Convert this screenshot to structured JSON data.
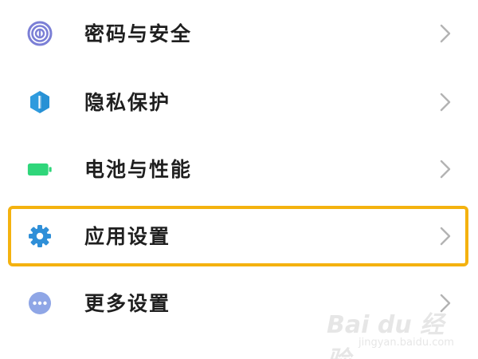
{
  "settings": {
    "items": [
      {
        "label": "密码与安全",
        "icon": "fingerprint-icon"
      },
      {
        "label": "隐私保护",
        "icon": "privacy-shield-icon"
      },
      {
        "label": "电池与性能",
        "icon": "battery-icon"
      },
      {
        "label": "应用设置",
        "icon": "gear-icon",
        "highlighted": true
      },
      {
        "label": "更多设置",
        "icon": "more-dots-icon"
      }
    ]
  },
  "colors": {
    "highlight_border": "#f4b20f",
    "fingerprint": "#7b7fd6",
    "shield": "#2f9bde",
    "battery": "#2fd67a",
    "gear": "#2f8fd8",
    "more": "#8fa6e6",
    "chevron": "#b3b3b3"
  },
  "watermark": {
    "logo": "Bai du 经验",
    "sub": "jingyan.baidu.com"
  }
}
